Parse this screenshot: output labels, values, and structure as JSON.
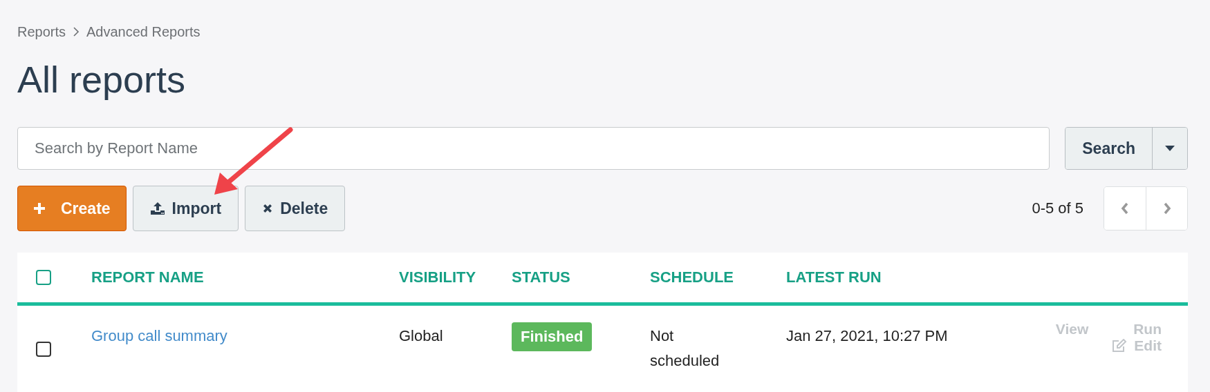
{
  "breadcrumb": [
    {
      "label": "Reports"
    },
    {
      "label": "Advanced Reports"
    }
  ],
  "title": "All reports",
  "search": {
    "placeholder": "Search by Report Name",
    "button": "Search"
  },
  "actions": [
    {
      "kind": "create",
      "label": "Create"
    },
    {
      "kind": "import",
      "label": "Import"
    },
    {
      "kind": "delete",
      "label": "Delete"
    }
  ],
  "pagination": {
    "range": "0-5 of 5"
  },
  "table": {
    "select_all": {
      "checked": false
    },
    "columns": [
      "REPORT NAME",
      "VISIBILITY",
      "STATUS",
      "SCHEDULE",
      "LATEST RUN"
    ],
    "rows": [
      {
        "checked": false,
        "name": "Group call summary",
        "visibility": "Global",
        "status": "Finished",
        "schedule": "Not scheduled",
        "latest_run": "Jan 27, 2021, 10:27 PM",
        "actions": [
          {
            "kind": "view",
            "label": "View",
            "disabled": true
          },
          {
            "kind": "run",
            "label": "Run",
            "disabled": true
          },
          {
            "kind": "edit",
            "label": "Edit",
            "disabled": true
          }
        ]
      }
    ]
  }
}
